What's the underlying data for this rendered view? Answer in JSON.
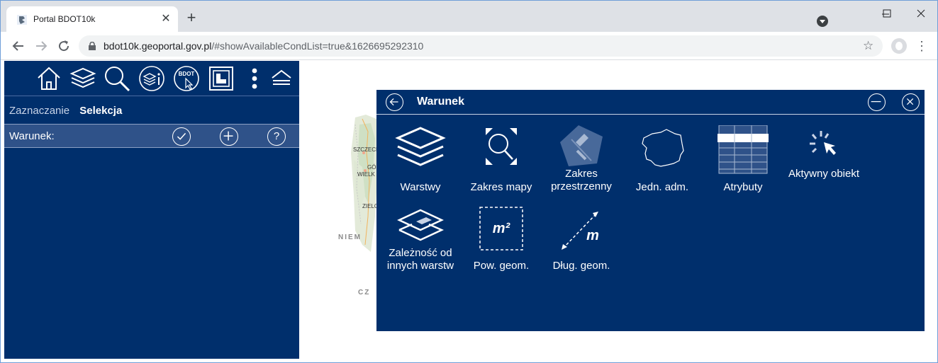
{
  "browser": {
    "tab_title": "Portal BDOT10k",
    "tab_close": "✕",
    "new_tab": "+",
    "url_host": "bdot10k.geoportal.gov.pl",
    "url_rest": "/#showAvailableCondList=true&1626695292310",
    "icons": [
      "bdot-favicon-icon",
      "back-arrow-icon",
      "forward-arrow-icon",
      "reload-icon",
      "lock-icon",
      "star-icon",
      "profile-avatar-icon",
      "menu-dots-icon",
      "minimize-icon",
      "maximize-icon",
      "close-window-icon"
    ]
  },
  "left_panel": {
    "toolbar_icons": [
      "home-icon",
      "layers-icon",
      "search-icon",
      "layer-info-icon",
      "bdot-select-icon",
      "frame-icon",
      "more-vertical-icon",
      "collapse-icon"
    ],
    "bdot_icon_text": "BDOT",
    "modes": {
      "zaznaczanie": "Zaznaczanie",
      "selekcja": "Selekcja"
    },
    "condition_label": "Warunek:",
    "condition_buttons": [
      "check-icon",
      "add-icon",
      "help-icon"
    ],
    "help_glyph": "?"
  },
  "map_labels": [
    "SZCZECI",
    "GÓ",
    "WIELK",
    "ZIELO",
    "NIEM",
    "CZ"
  ],
  "dialog": {
    "title": "Warunek",
    "options": [
      {
        "label": "Warstwy",
        "icon": "layers-stack-icon"
      },
      {
        "label": "Zakres mapy",
        "icon": "map-extent-zoom-icon"
      },
      {
        "label": "Zakres przestrzenny",
        "icon": "spatial-extent-icon"
      },
      {
        "label": "Jedn. adm.",
        "icon": "poland-outline-icon"
      },
      {
        "label": "Atrybuty",
        "icon": "attribute-table-icon"
      },
      {
        "label": "Aktywny obiekt",
        "icon": "active-object-cursor-icon"
      },
      {
        "label": "Zależność od innych warstw",
        "icon": "layer-dependency-icon"
      },
      {
        "label": "Pow. geom.",
        "icon": "area-m2-icon"
      },
      {
        "label": "Dług. geom.",
        "icon": "length-m-icon"
      }
    ],
    "area_glyph": "m²",
    "length_glyph": "m"
  },
  "colors": {
    "panel": "#002f6c",
    "condition_bar": "#2f5289",
    "frame": "#6f9ed8"
  }
}
